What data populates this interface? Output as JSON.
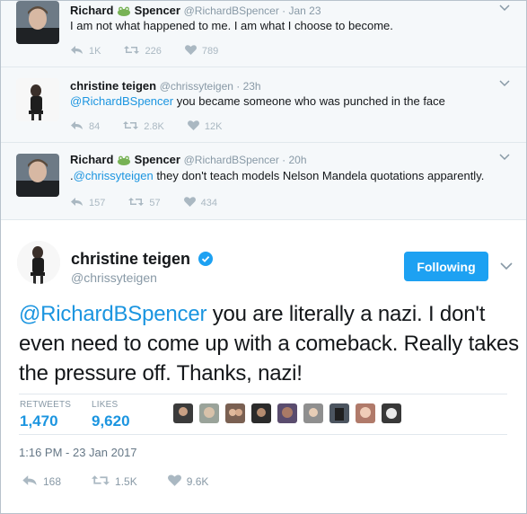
{
  "replies": [
    {
      "name_first": "Richard",
      "name_last": "Spencer",
      "meta": "@RichardBSpencer · Jan 23",
      "text_mention": "",
      "text": "I am not what happened to me. I am what I choose to become.",
      "actions": {
        "reply": "1K",
        "retweet": "226",
        "like": "789"
      }
    },
    {
      "name_first": "christine teigen",
      "meta": "@chrissyteigen · 23h",
      "text_mention": "@RichardBSpencer",
      "text": " you became someone who was punched in the face",
      "actions": {
        "reply": "84",
        "retweet": "2.8K",
        "like": "12K"
      }
    },
    {
      "name_first": "Richard",
      "name_last": "Spencer",
      "meta": "@RichardBSpencer · 20h",
      "text_prefix": ".",
      "text_mention": "@chrissyteigen",
      "text": " they don't teach models Nelson Mandela quotations apparently.",
      "actions": {
        "reply": "157",
        "retweet": "57",
        "like": "434"
      }
    }
  ],
  "main": {
    "name": "christine teigen",
    "handle": "@chrissyteigen",
    "follow_label": "Following",
    "text_mention": "@RichardBSpencer",
    "text": " you are literally a nazi. I don't even need to come up with a comeback. Really takes the pressure off. Thanks, nazi!",
    "retweets_label": "RETWEETS",
    "retweets_value": "1,470",
    "likes_label": "LIKES",
    "likes_value": "9,620",
    "timestamp": "1:16 PM - 23 Jan 2017",
    "actions": {
      "reply": "168",
      "retweet": "1.5K",
      "like": "9.6K"
    }
  },
  "colors": {
    "accent": "#1da1f2",
    "link": "#1b95e0",
    "muted": "#8899a6",
    "reply_bg": "#f5f8fa"
  },
  "icons": [
    "reply-icon",
    "retweet-icon",
    "heart-icon",
    "verified-badge-icon",
    "frog-emoji-icon",
    "chevron-down-icon"
  ]
}
